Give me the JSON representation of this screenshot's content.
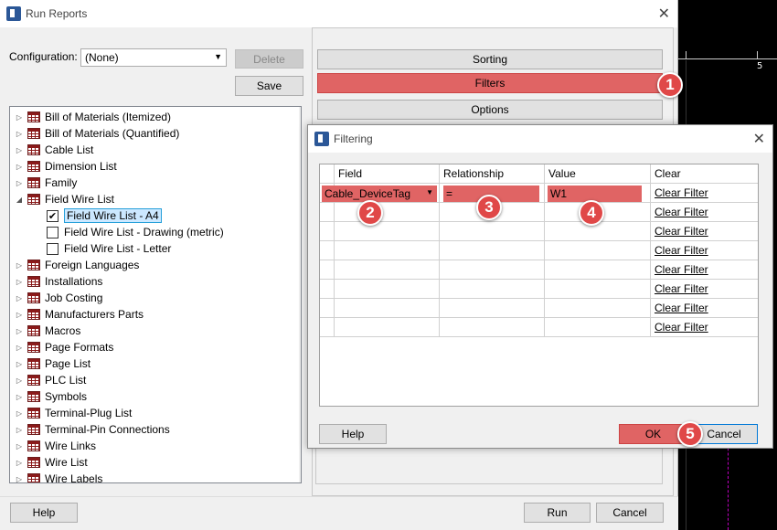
{
  "main_dialog": {
    "title": "Run Reports",
    "config_label": "Configuration:",
    "config_value": "(None)",
    "delete_label": "Delete",
    "save_label": "Save",
    "sorting_label": "Sorting",
    "filters_label": "Filters",
    "options_label": "Options",
    "help_label": "Help",
    "run_label": "Run",
    "cancel_label": "Cancel"
  },
  "tree": {
    "items": [
      {
        "label": "Bill of Materials (Itemized)",
        "kind": "folder"
      },
      {
        "label": "Bill of Materials (Quantified)",
        "kind": "folder"
      },
      {
        "label": "Cable List",
        "kind": "folder"
      },
      {
        "label": "Dimension List",
        "kind": "folder"
      },
      {
        "label": "Family",
        "kind": "folder"
      },
      {
        "label": "Field Wire List",
        "kind": "folder-open"
      },
      {
        "label": "Field Wire List - A4",
        "kind": "child",
        "checked": true,
        "selected": true
      },
      {
        "label": "Field Wire List - Drawing (metric)",
        "kind": "child",
        "checked": false
      },
      {
        "label": "Field Wire List - Letter",
        "kind": "child",
        "checked": false
      },
      {
        "label": "Foreign Languages",
        "kind": "folder"
      },
      {
        "label": "Installations",
        "kind": "folder"
      },
      {
        "label": "Job Costing",
        "kind": "folder"
      },
      {
        "label": "Manufacturers Parts",
        "kind": "folder"
      },
      {
        "label": "Macros",
        "kind": "folder"
      },
      {
        "label": "Page Formats",
        "kind": "folder"
      },
      {
        "label": "Page List",
        "kind": "folder"
      },
      {
        "label": "PLC List",
        "kind": "folder"
      },
      {
        "label": "Symbols",
        "kind": "folder"
      },
      {
        "label": "Terminal-Plug List",
        "kind": "folder"
      },
      {
        "label": "Terminal-Pin Connections",
        "kind": "folder"
      },
      {
        "label": "Wire Links",
        "kind": "folder"
      },
      {
        "label": "Wire List",
        "kind": "folder"
      },
      {
        "label": "Wire Labels",
        "kind": "folder"
      }
    ]
  },
  "filtering": {
    "title": "Filtering",
    "columns": [
      "Field",
      "Relationship",
      "Value",
      "Clear"
    ],
    "first_row": {
      "field": "Cable_DeviceTag",
      "relationship": "=",
      "value": "W1"
    },
    "clear_label": "Clear Filter",
    "row_count": 8,
    "help_label": "Help",
    "ok_label": "OK",
    "cancel_label": "Cancel"
  },
  "badges": [
    "1",
    "2",
    "3",
    "4",
    "5"
  ],
  "background": {
    "ruler_number": "5"
  },
  "colors": {
    "highlight": "#e06464",
    "badge": "#e04848",
    "selection": "#cce8ff"
  }
}
